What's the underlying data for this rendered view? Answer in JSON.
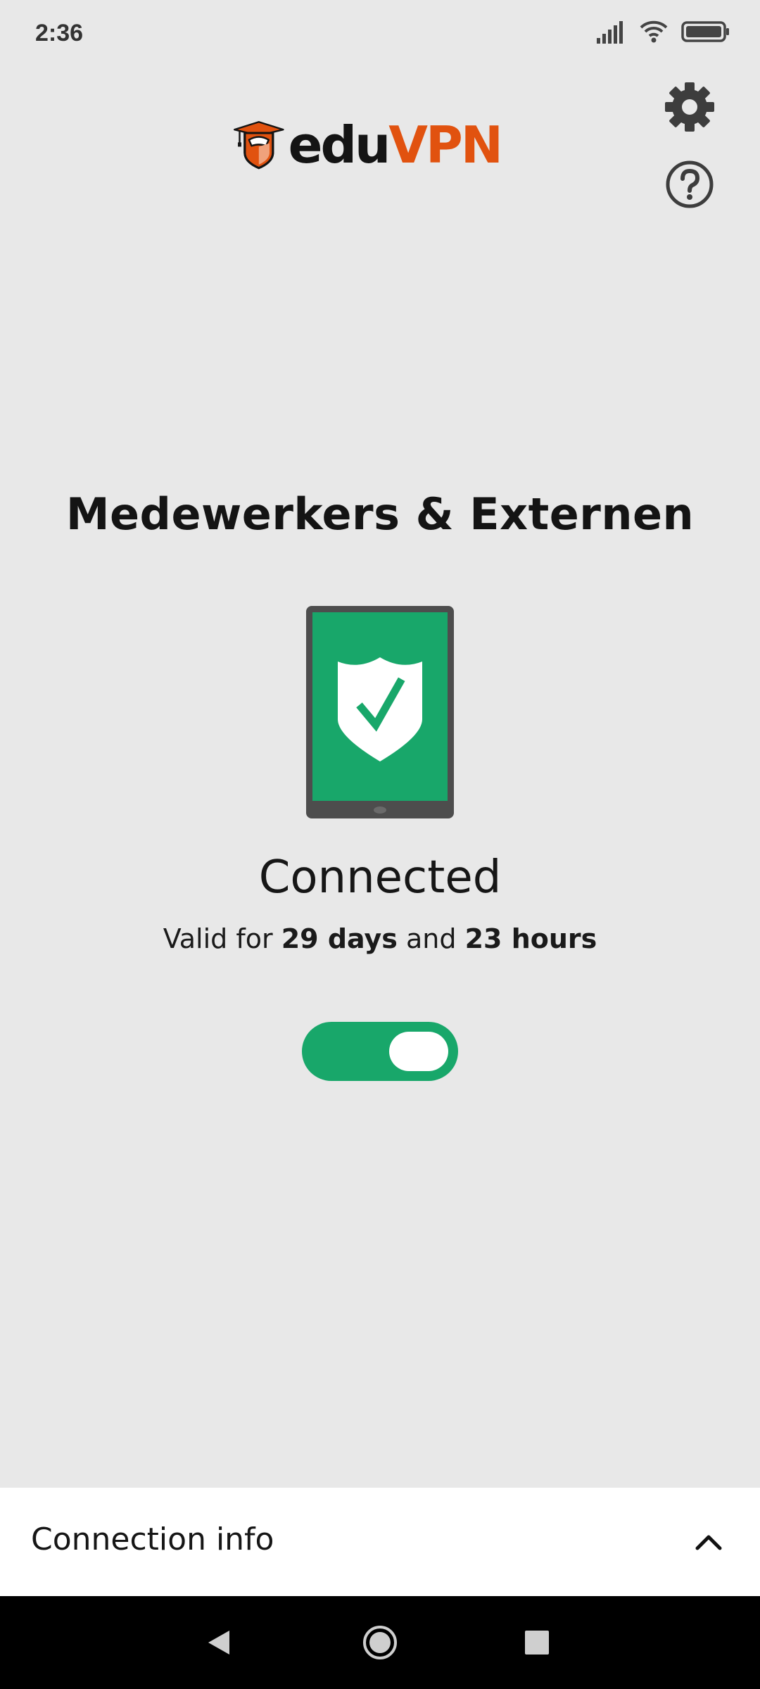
{
  "status_bar": {
    "time": "2:36",
    "icons": [
      "signal-icon",
      "wifi-icon",
      "battery-icon"
    ]
  },
  "header": {
    "logo_part1": "edu",
    "logo_part2": "VPN",
    "settings_icon": "gear-icon",
    "help_icon": "help-icon"
  },
  "main": {
    "server_name": "Medewerkers & Externen",
    "status": "Connected",
    "validity_prefix": "Valid for",
    "validity_days": "29 days",
    "validity_joiner": "and",
    "validity_hours": "23 hours",
    "toggle_on": true
  },
  "bottom_sheet": {
    "label": "Connection info",
    "expand_icon": "chevron-up-icon"
  },
  "nav_bar": {
    "icons": [
      "back-icon",
      "home-icon",
      "recents-icon"
    ]
  },
  "colors": {
    "accent_green": "#18a76a",
    "brand_orange": "#e1520f",
    "background": "#e8e8e8",
    "device_frame": "#4d4d4d"
  }
}
